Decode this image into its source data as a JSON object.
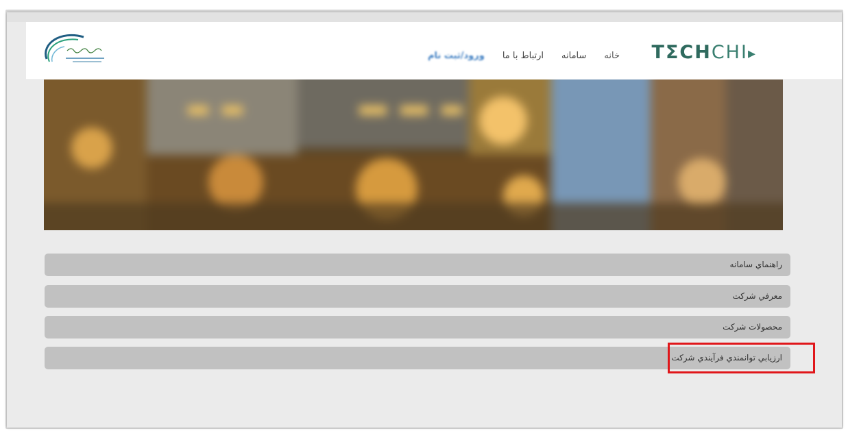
{
  "header": {
    "brand": {
      "bold": "TΣCH",
      "thin": "CHI",
      "arrow": "▸"
    },
    "nav": [
      {
        "label": "خانه",
        "state": "home"
      },
      {
        "label": "سامانه",
        "state": ""
      },
      {
        "label": "ارتباط با ما",
        "state": ""
      },
      {
        "label": "ورود/ثبت نام",
        "state": "active"
      }
    ],
    "org_logo": "petrochemical-company-logo"
  },
  "accordion": [
    {
      "label": "راهنماي سامانه"
    },
    {
      "label": "معرفي شركت"
    },
    {
      "label": "محصولات شركت"
    },
    {
      "label": "ارزيابي توانمندي فرآيندي شركت"
    }
  ],
  "colors": {
    "brand": "#2f6a5e",
    "accordion_bg": "#c1c1c1",
    "highlight": "#e0161a",
    "nav_active": "#3f7fc2"
  }
}
